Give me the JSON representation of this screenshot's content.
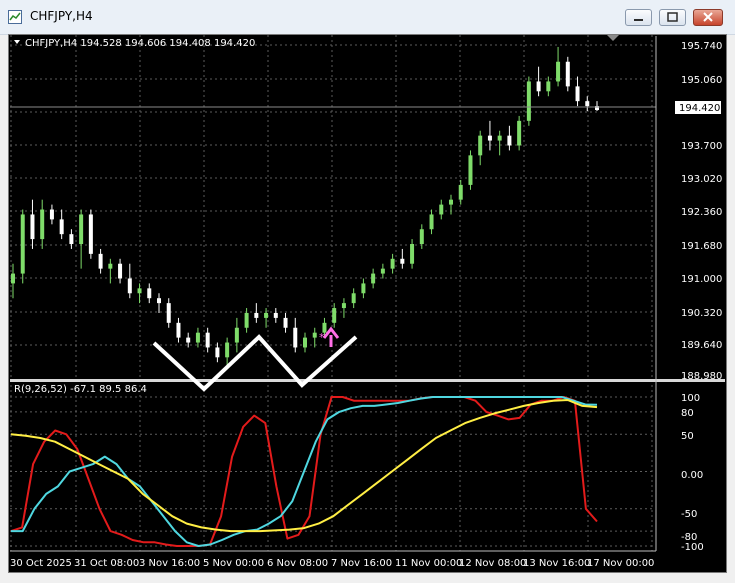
{
  "window": {
    "title": "CHFJPY,H4"
  },
  "price_panel": {
    "header": "CHFJPY,H4  194.528 194.606 194.408 194.420",
    "price_labels": [
      "195.740",
      "195.060",
      "193.700",
      "193.020",
      "192.360",
      "191.680",
      "191.000",
      "190.320",
      "189.640",
      "188.980"
    ],
    "current_price": "194.420"
  },
  "indicator_panel": {
    "header": "R(9,26,52) -67.1 89.5 86.4",
    "level_labels": [
      "100",
      "80",
      "50",
      "0.00",
      "-50",
      "-80",
      "-100"
    ]
  },
  "time_axis": {
    "labels": [
      "30 Oct 2025",
      "31 Oct 08:00",
      "3 Nov 16:00",
      "5 Nov 00:00",
      "6 Nov 08:00",
      "7 Nov 16:00",
      "11 Nov 00:00",
      "12 Nov 08:00",
      "13 Nov 16:00",
      "17 Nov 00:00"
    ]
  },
  "colors": {
    "bull": "#7fdc6a",
    "bear": "#ffffff",
    "bg": "#000000",
    "grid": "#5d5d5d",
    "line_red": "#e31b1b",
    "line_yellow": "#ffee44",
    "line_cyan": "#4fd7e0",
    "pattern": "#ffffff",
    "arrow": "#ff6ee6"
  },
  "annotations": {
    "pattern": "white W-shaped double-bottom zigzag",
    "arrow": "magenta up-arrow buy signal"
  },
  "chart_data": {
    "type": "candlestick",
    "symbol": "CHFJPY",
    "timeframe": "H4",
    "ylim": [
      188.98,
      195.74
    ],
    "candles": [
      [
        190.9,
        191.3,
        190.6,
        191.1
      ],
      [
        191.1,
        192.4,
        190.9,
        192.3
      ],
      [
        192.3,
        192.6,
        191.6,
        191.8
      ],
      [
        191.8,
        192.6,
        191.6,
        192.4
      ],
      [
        192.4,
        192.5,
        192.1,
        192.2
      ],
      [
        192.2,
        192.4,
        191.8,
        191.9
      ],
      [
        191.9,
        192.0,
        191.6,
        191.7
      ],
      [
        191.7,
        192.4,
        191.2,
        192.3
      ],
      [
        192.3,
        192.4,
        191.4,
        191.5
      ],
      [
        191.5,
        191.6,
        191.1,
        191.2
      ],
      [
        191.2,
        191.4,
        190.9,
        191.3
      ],
      [
        191.3,
        191.4,
        190.9,
        191.0
      ],
      [
        191.0,
        191.3,
        190.6,
        190.7
      ],
      [
        190.7,
        190.9,
        190.5,
        190.8
      ],
      [
        190.8,
        190.9,
        190.5,
        190.6
      ],
      [
        190.6,
        190.7,
        190.3,
        190.5
      ],
      [
        190.5,
        190.6,
        190.0,
        190.1
      ],
      [
        190.1,
        190.2,
        189.7,
        189.8
      ],
      [
        189.8,
        189.9,
        189.6,
        189.7
      ],
      [
        189.7,
        190.0,
        189.6,
        189.9
      ],
      [
        189.9,
        190.0,
        189.5,
        189.6
      ],
      [
        189.6,
        189.7,
        189.3,
        189.4
      ],
      [
        189.4,
        189.8,
        189.2,
        189.7
      ],
      [
        189.7,
        190.2,
        189.5,
        190.0
      ],
      [
        190.0,
        190.4,
        189.9,
        190.3
      ],
      [
        190.3,
        190.5,
        190.1,
        190.2
      ],
      [
        190.2,
        190.4,
        190.0,
        190.3
      ],
      [
        190.3,
        190.4,
        190.1,
        190.2
      ],
      [
        190.2,
        190.3,
        189.9,
        190.0
      ],
      [
        190.0,
        190.2,
        189.5,
        189.6
      ],
      [
        189.6,
        189.9,
        189.5,
        189.8
      ],
      [
        189.8,
        190.0,
        189.6,
        189.9
      ],
      [
        189.9,
        190.2,
        189.8,
        190.1
      ],
      [
        190.1,
        190.5,
        190.0,
        190.4
      ],
      [
        190.4,
        190.6,
        190.2,
        190.5
      ],
      [
        190.5,
        190.8,
        190.4,
        190.7
      ],
      [
        190.7,
        191.0,
        190.6,
        190.9
      ],
      [
        190.9,
        191.2,
        190.8,
        191.1
      ],
      [
        191.1,
        191.3,
        191.0,
        191.2
      ],
      [
        191.2,
        191.5,
        191.1,
        191.4
      ],
      [
        191.4,
        191.6,
        191.2,
        191.3
      ],
      [
        191.3,
        191.8,
        191.2,
        191.7
      ],
      [
        191.7,
        192.1,
        191.6,
        192.0
      ],
      [
        192.0,
        192.4,
        191.9,
        192.3
      ],
      [
        192.3,
        192.6,
        192.2,
        192.5
      ],
      [
        192.5,
        192.7,
        192.3,
        192.6
      ],
      [
        192.6,
        193.0,
        192.5,
        192.9
      ],
      [
        192.9,
        193.6,
        192.8,
        193.5
      ],
      [
        193.5,
        194.0,
        193.3,
        193.9
      ],
      [
        193.9,
        194.2,
        193.6,
        193.8
      ],
      [
        193.8,
        194.0,
        193.5,
        193.9
      ],
      [
        193.9,
        194.1,
        193.6,
        193.7
      ],
      [
        193.7,
        194.3,
        193.6,
        194.2
      ],
      [
        194.2,
        195.1,
        194.1,
        195.0
      ],
      [
        195.0,
        195.3,
        194.7,
        194.8
      ],
      [
        194.8,
        195.1,
        194.7,
        195.0
      ],
      [
        195.0,
        195.7,
        194.9,
        195.4
      ],
      [
        195.4,
        195.5,
        194.8,
        194.9
      ],
      [
        194.9,
        195.1,
        194.5,
        194.6
      ],
      [
        194.6,
        194.7,
        194.4,
        194.5
      ],
      [
        194.5,
        194.6,
        194.4,
        194.42
      ]
    ],
    "indicator": {
      "name": "R(9,26,52)",
      "ylim": [
        -100,
        100
      ],
      "series": [
        {
          "values": [
            -80,
            -75,
            10,
            40,
            55,
            50,
            30,
            -10,
            -50,
            -80,
            -85,
            -92,
            -95,
            -95,
            -98,
            -100,
            -100,
            -100,
            -98,
            -60,
            20,
            60,
            75,
            65,
            -20,
            -90,
            -85,
            -60,
            50,
            100,
            100,
            95,
            95,
            95,
            95,
            95,
            95,
            98,
            100,
            100,
            100,
            100,
            95,
            80,
            75,
            70,
            72,
            90,
            95,
            95,
            100,
            95,
            -50,
            -67.1
          ]
        },
        {
          "values": [
            -80,
            -80,
            -50,
            -30,
            -20,
            0,
            5,
            10,
            20,
            10,
            -10,
            -20,
            -40,
            -60,
            -80,
            -95,
            -100,
            -98,
            -92,
            -85,
            -80,
            -78,
            -70,
            -60,
            -40,
            0,
            40,
            70,
            80,
            85,
            88,
            88,
            90,
            92,
            95,
            98,
            100,
            100,
            100,
            100,
            100,
            100,
            100,
            100,
            100,
            100,
            100,
            100,
            95,
            90,
            89.5
          ]
        },
        {
          "values": [
            50,
            48,
            45,
            40,
            30,
            20,
            10,
            0,
            -10,
            -30,
            -45,
            -60,
            -70,
            -75,
            -78,
            -80,
            -80,
            -80,
            -79,
            -78,
            -76,
            -70,
            -60,
            -45,
            -30,
            -15,
            0,
            15,
            30,
            45,
            55,
            65,
            72,
            78,
            83,
            88,
            92,
            95,
            96,
            88,
            86.4
          ]
        }
      ]
    }
  }
}
